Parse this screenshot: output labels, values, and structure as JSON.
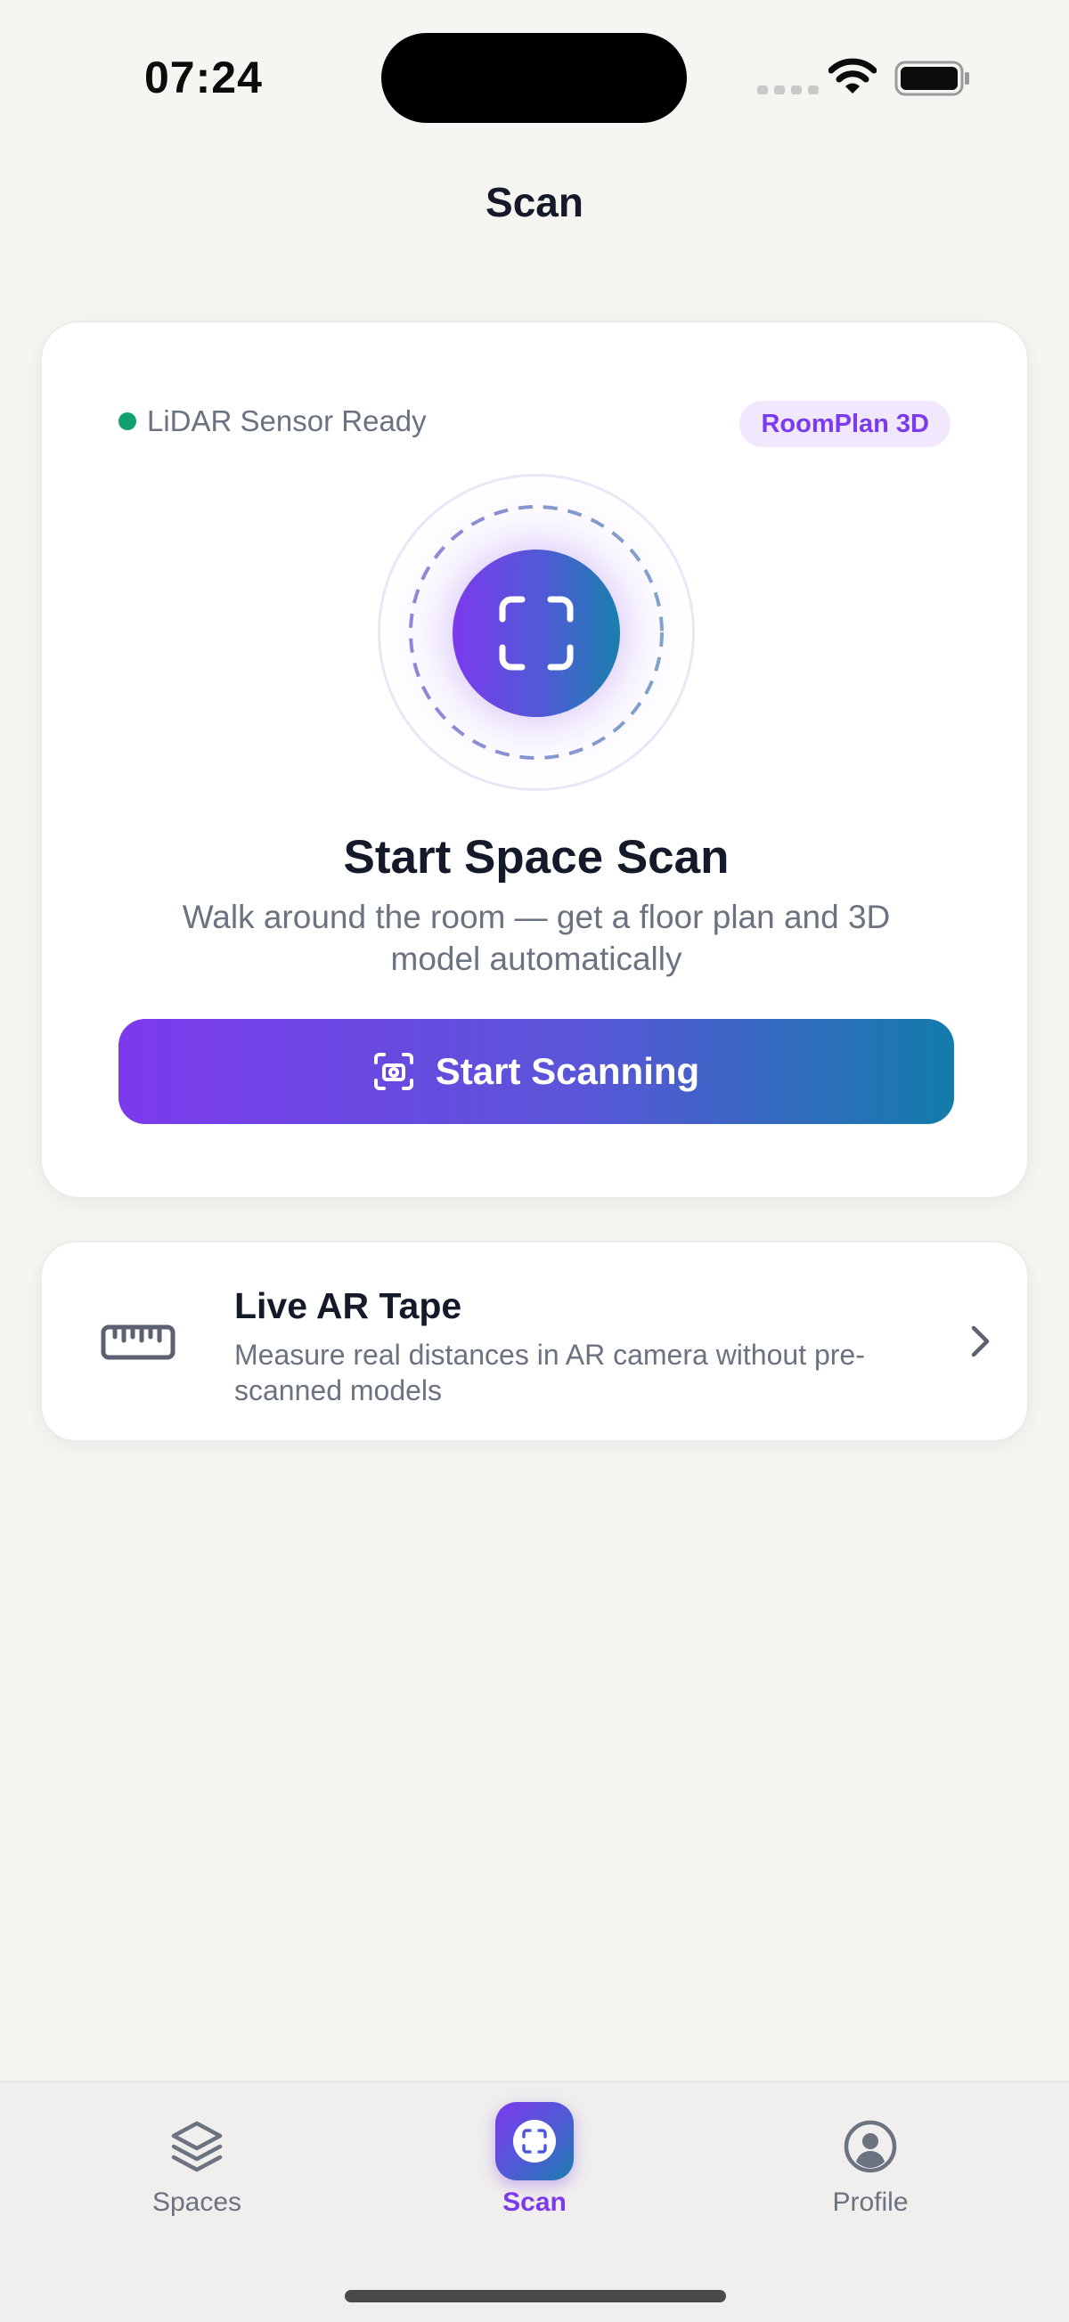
{
  "status_bar": {
    "time": "07:24"
  },
  "nav": {
    "title": "Scan"
  },
  "scan_card": {
    "sensor_status": "LiDAR Sensor Ready",
    "badge": "RoomPlan 3D",
    "title": "Start Space Scan",
    "description": "Walk around the room — get a floor plan and 3D model automatically",
    "start_button_label": "Start Scanning",
    "status_color": "#11a06e",
    "accent_color": "#7c3aed"
  },
  "ar_card": {
    "title": "Live AR Tape",
    "description": "Measure real distances in AR camera without pre-scanned models"
  },
  "tab_bar": {
    "spaces_label": "Spaces",
    "scan_label": "Scan",
    "profile_label": "Profile",
    "active_tab": "Scan"
  }
}
